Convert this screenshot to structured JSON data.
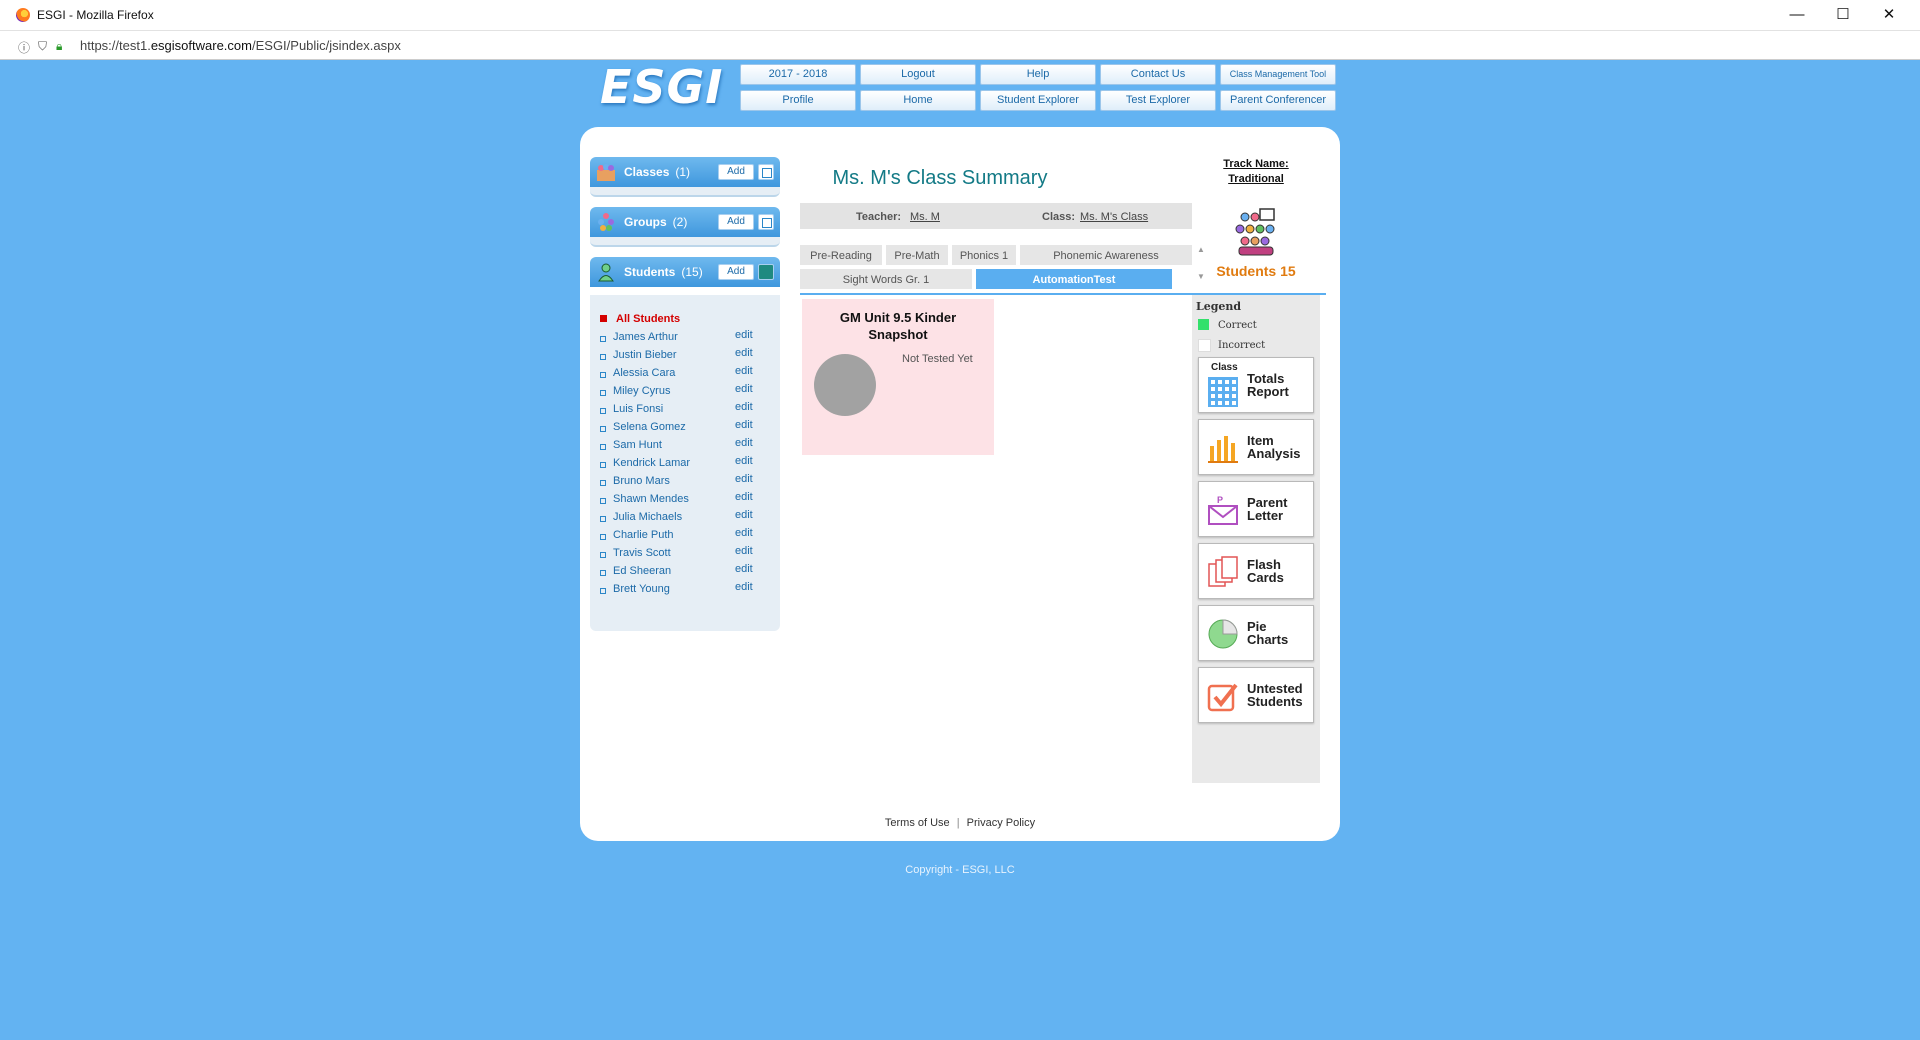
{
  "browser": {
    "window_title": "ESGI - Mozilla Firefox",
    "url_prefix": "https://test1.",
    "url_domain": "esgisoftware.com",
    "url_path": "/ESGI/Public/jsindex.aspx",
    "controls": {
      "minimize": "—",
      "maximize": "☐",
      "close": "✕"
    }
  },
  "logo": "ESGI",
  "nav": {
    "row1": [
      "2017 - 2018",
      "Logout",
      "Help",
      "Contact Us",
      "Class Management Tool"
    ],
    "row2": [
      "Profile",
      "Home",
      "Student Explorer",
      "Test Explorer",
      "Parent Conferencer"
    ]
  },
  "sidebar": {
    "classes": {
      "title": "Classes",
      "count": "(1)",
      "add": "Add"
    },
    "groups": {
      "title": "Groups",
      "count": "(2)",
      "add": "Add"
    },
    "students": {
      "title": "Students",
      "count": "(15)",
      "add": "Add",
      "all_label": "All Students",
      "edit_label": "edit",
      "list": [
        "James Arthur",
        "Justin Bieber",
        "Alessia Cara",
        "Miley Cyrus",
        "Luis Fonsi",
        "Selena Gomez",
        "Sam Hunt",
        "Kendrick Lamar",
        "Bruno Mars",
        "Shawn Mendes",
        "Julia Michaels",
        "Charlie Puth",
        "Travis Scott",
        "Ed Sheeran",
        "Brett Young"
      ]
    }
  },
  "main": {
    "title": "Ms. M's Class Summary",
    "teacher_label": "Teacher:",
    "teacher_value": "Ms. M",
    "class_label": "Class:",
    "class_value": "Ms. M's Class",
    "tabs_row1": [
      "Pre-Reading",
      "Pre-Math",
      "Phonics 1",
      "Phonemic Awareness"
    ],
    "tabs_row2": [
      "Sight Words Gr. 1",
      "AutomationTest"
    ],
    "active_tab": "AutomationTest",
    "test_card": {
      "name": "GM Unit 9.5 Kinder Snapshot",
      "status": "Not Tested Yet"
    }
  },
  "right": {
    "track_label": "Track Name:",
    "track_value": "Traditional",
    "students_label": "Students 15",
    "legend": {
      "title": "Legend",
      "correct": "Correct",
      "incorrect": "Incorrect",
      "correct_color": "#33e06b",
      "incorrect_color": "#ffffff"
    },
    "reports": [
      {
        "icon": "class-totals-icon",
        "top": "Class",
        "line1": "Totals",
        "line2": "Report"
      },
      {
        "icon": "item-analysis-icon",
        "line1": "Item",
        "line2": "Analysis"
      },
      {
        "icon": "parent-letter-icon",
        "line1": "Parent",
        "line2": "Letter"
      },
      {
        "icon": "flash-cards-icon",
        "line1": "Flash",
        "line2": "Cards"
      },
      {
        "icon": "pie-charts-icon",
        "line1": "Pie",
        "line2": "Charts"
      },
      {
        "icon": "untested-students-icon",
        "line1": "Untested",
        "line2": "Students"
      }
    ]
  },
  "footer": {
    "terms": "Terms of Use",
    "sep": "|",
    "privacy": "Privacy Policy",
    "copyright": "Copyright - ESGI, LLC"
  },
  "colors": {
    "background": "#63b3f2",
    "accent": "#5aaef0",
    "title_teal": "#137a86",
    "students_orange": "#e07b10",
    "all_students_red": "#d40000"
  }
}
